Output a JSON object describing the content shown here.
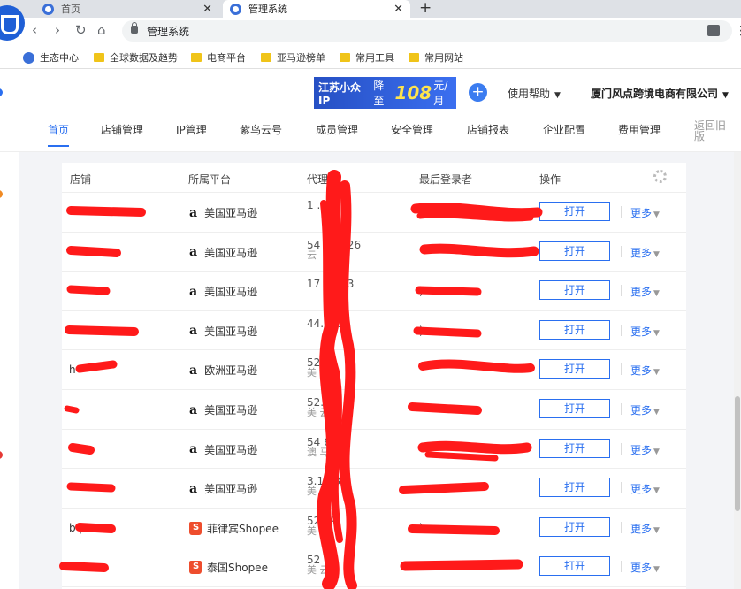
{
  "browser": {
    "tabs": [
      {
        "title": "首页"
      },
      {
        "title": "管理系统"
      }
    ],
    "address": "管理系统",
    "bookmarks": [
      "生态中心",
      "全球数据及趋势",
      "电商平台",
      "亚马逊榜单",
      "常用工具",
      "常用网站"
    ]
  },
  "header": {
    "promo_left": "江苏小众IP",
    "promo_mid": "降至",
    "promo_price": "108",
    "promo_unit": "元/月",
    "help": "使用帮助",
    "company": "厦门风点跨境电商有限公司"
  },
  "nav": {
    "items": [
      "首页",
      "店铺管理",
      "IP管理",
      "紫鸟云号",
      "成员管理",
      "安全管理",
      "店铺报表",
      "企业配置",
      "费用管理"
    ],
    "back_old": "返回旧版"
  },
  "table": {
    "columns": [
      "店铺",
      "所属平台",
      "代理IP",
      "最后登录者",
      "操作"
    ],
    "open_label": "打开",
    "more_label": "更多",
    "rows": [
      {
        "shop": "",
        "platform": "美国亚马逊",
        "platform_icon": "amazon-icon",
        "ip": "1  .13",
        "ip_sub": "",
        "user": ""
      },
      {
        "shop": "",
        "platform": "美国亚马逊",
        "platform_icon": "amazon-icon",
        "ip": "54 03.126",
        "ip_sub": "云",
        "user": ""
      },
      {
        "shop": "",
        "platform": "美国亚马逊",
        "platform_icon": "amazon-icon",
        "ip": "17  119.3",
        "ip_sub": "",
        "user": ")"
      },
      {
        "shop": "",
        "platform": "美国亚马逊",
        "platform_icon": "amazon-icon",
        "ip": "44.  .83",
        "ip_sub": "",
        "user": ")"
      },
      {
        "shop": "h",
        "platform": "欧洲亚马逊",
        "platform_icon": "amazon-icon",
        "ip": "52.  5",
        "ip_sub": "美  云",
        "user": ""
      },
      {
        "shop": "",
        "platform": "美国亚马逊",
        "platform_icon": "amazon-icon",
        "ip": "52.  30",
        "ip_sub": "美  云",
        "user": ""
      },
      {
        "shop": "",
        "platform": "美国亚马逊",
        "platform_icon": "amazon-icon",
        "ip": "54  64",
        "ip_sub": "澳  马逊云",
        "user": ""
      },
      {
        "shop": "",
        "platform": "美国亚马逊",
        "platform_icon": "amazon-icon",
        "ip": "3.1  239",
        "ip_sub": "美  云",
        "user": ""
      },
      {
        "shop": "b   ph",
        "platform": "菲律宾Shopee",
        "platform_icon": "shopee-icon",
        "ip": "52  69",
        "ip_sub": "美  云",
        "user": ")"
      },
      {
        "shop": "e.th",
        "platform": "泰国Shopee",
        "platform_icon": "shopee-icon",
        "ip": "52  69",
        "ip_sub": "美  云",
        "user": ""
      }
    ]
  }
}
